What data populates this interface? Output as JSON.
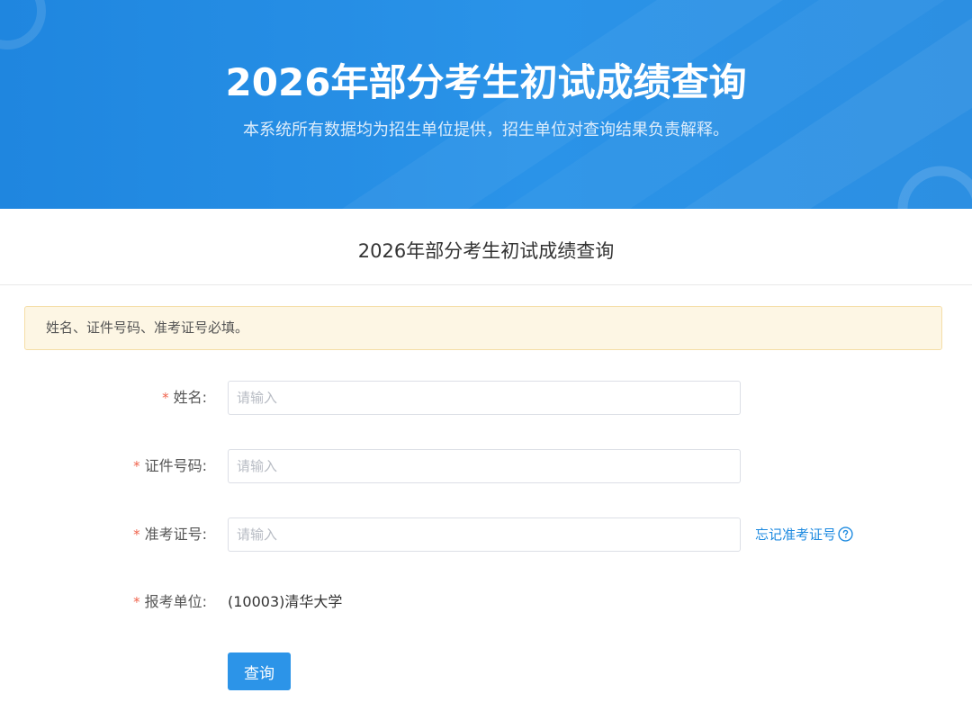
{
  "banner": {
    "title": "2026年部分考生初试成绩查询",
    "subtitle": "本系统所有数据均为招生单位提供，招生单位对查询结果负责解释。"
  },
  "section": {
    "title": "2026年部分考生初试成绩查询"
  },
  "notice": {
    "text": "姓名、证件号码、准考证号必填。"
  },
  "form": {
    "required_mark": "*",
    "name": {
      "label": "姓名:",
      "placeholder": "请输入",
      "value": ""
    },
    "id_number": {
      "label": "证件号码:",
      "placeholder": "请输入",
      "value": ""
    },
    "exam_number": {
      "label": "准考证号:",
      "placeholder": "请输入",
      "value": "",
      "forgot_link": "忘记准考证号"
    },
    "unit": {
      "label": "报考单位:",
      "value": "(10003)清华大学"
    },
    "submit_label": "查询"
  },
  "colors": {
    "banner_blue": "#2a93e8",
    "link_blue": "#1d8ae0",
    "required_red": "#f0644d",
    "notice_bg": "#fdf6e4",
    "button_blue": "#2c94e8"
  },
  "icons": {
    "help": "question-circle-icon"
  }
}
